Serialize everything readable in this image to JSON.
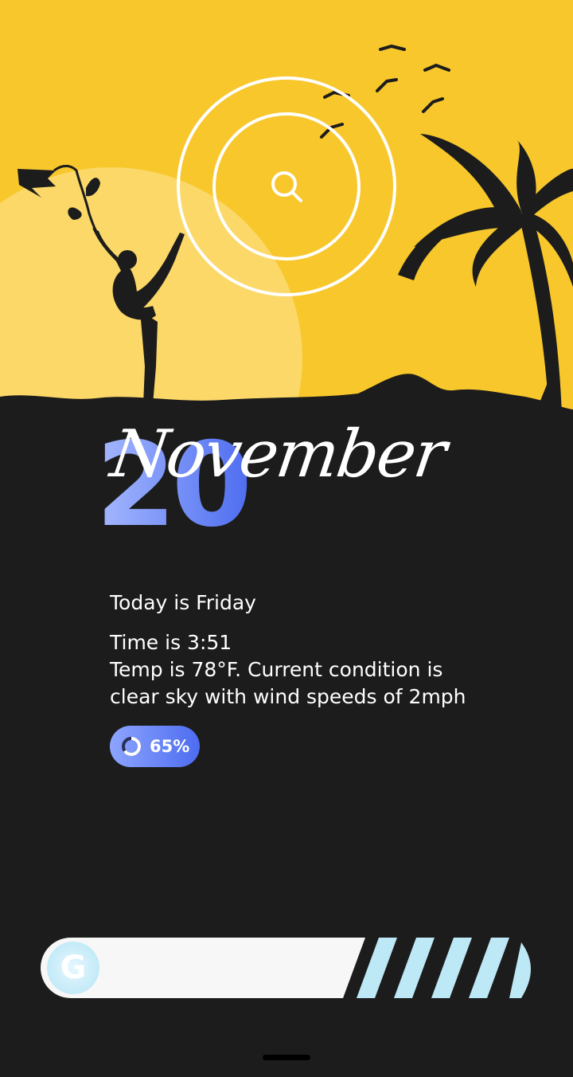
{
  "date": {
    "day": "20",
    "month": "November"
  },
  "info": {
    "day_line": "Today is Friday",
    "time_line": "Time is 3:51",
    "weather_line1": "Temp is 78°F. Current condition is",
    "weather_line2": "clear sky with wind speeds of 2mph"
  },
  "battery": {
    "text": "65%",
    "level": 0.65
  },
  "search": {
    "logo_letter": "G"
  },
  "colors": {
    "sky": "#f7c72c",
    "sun": "#fbd868",
    "silhouette": "#1c1c1c",
    "accent_start": "#8da5ff",
    "accent_end": "#4d6cf0",
    "search_stripes": "#bde8f6"
  },
  "icons": {
    "search": "search-icon",
    "battery": "battery-ring-icon",
    "google": "google-g-icon"
  }
}
